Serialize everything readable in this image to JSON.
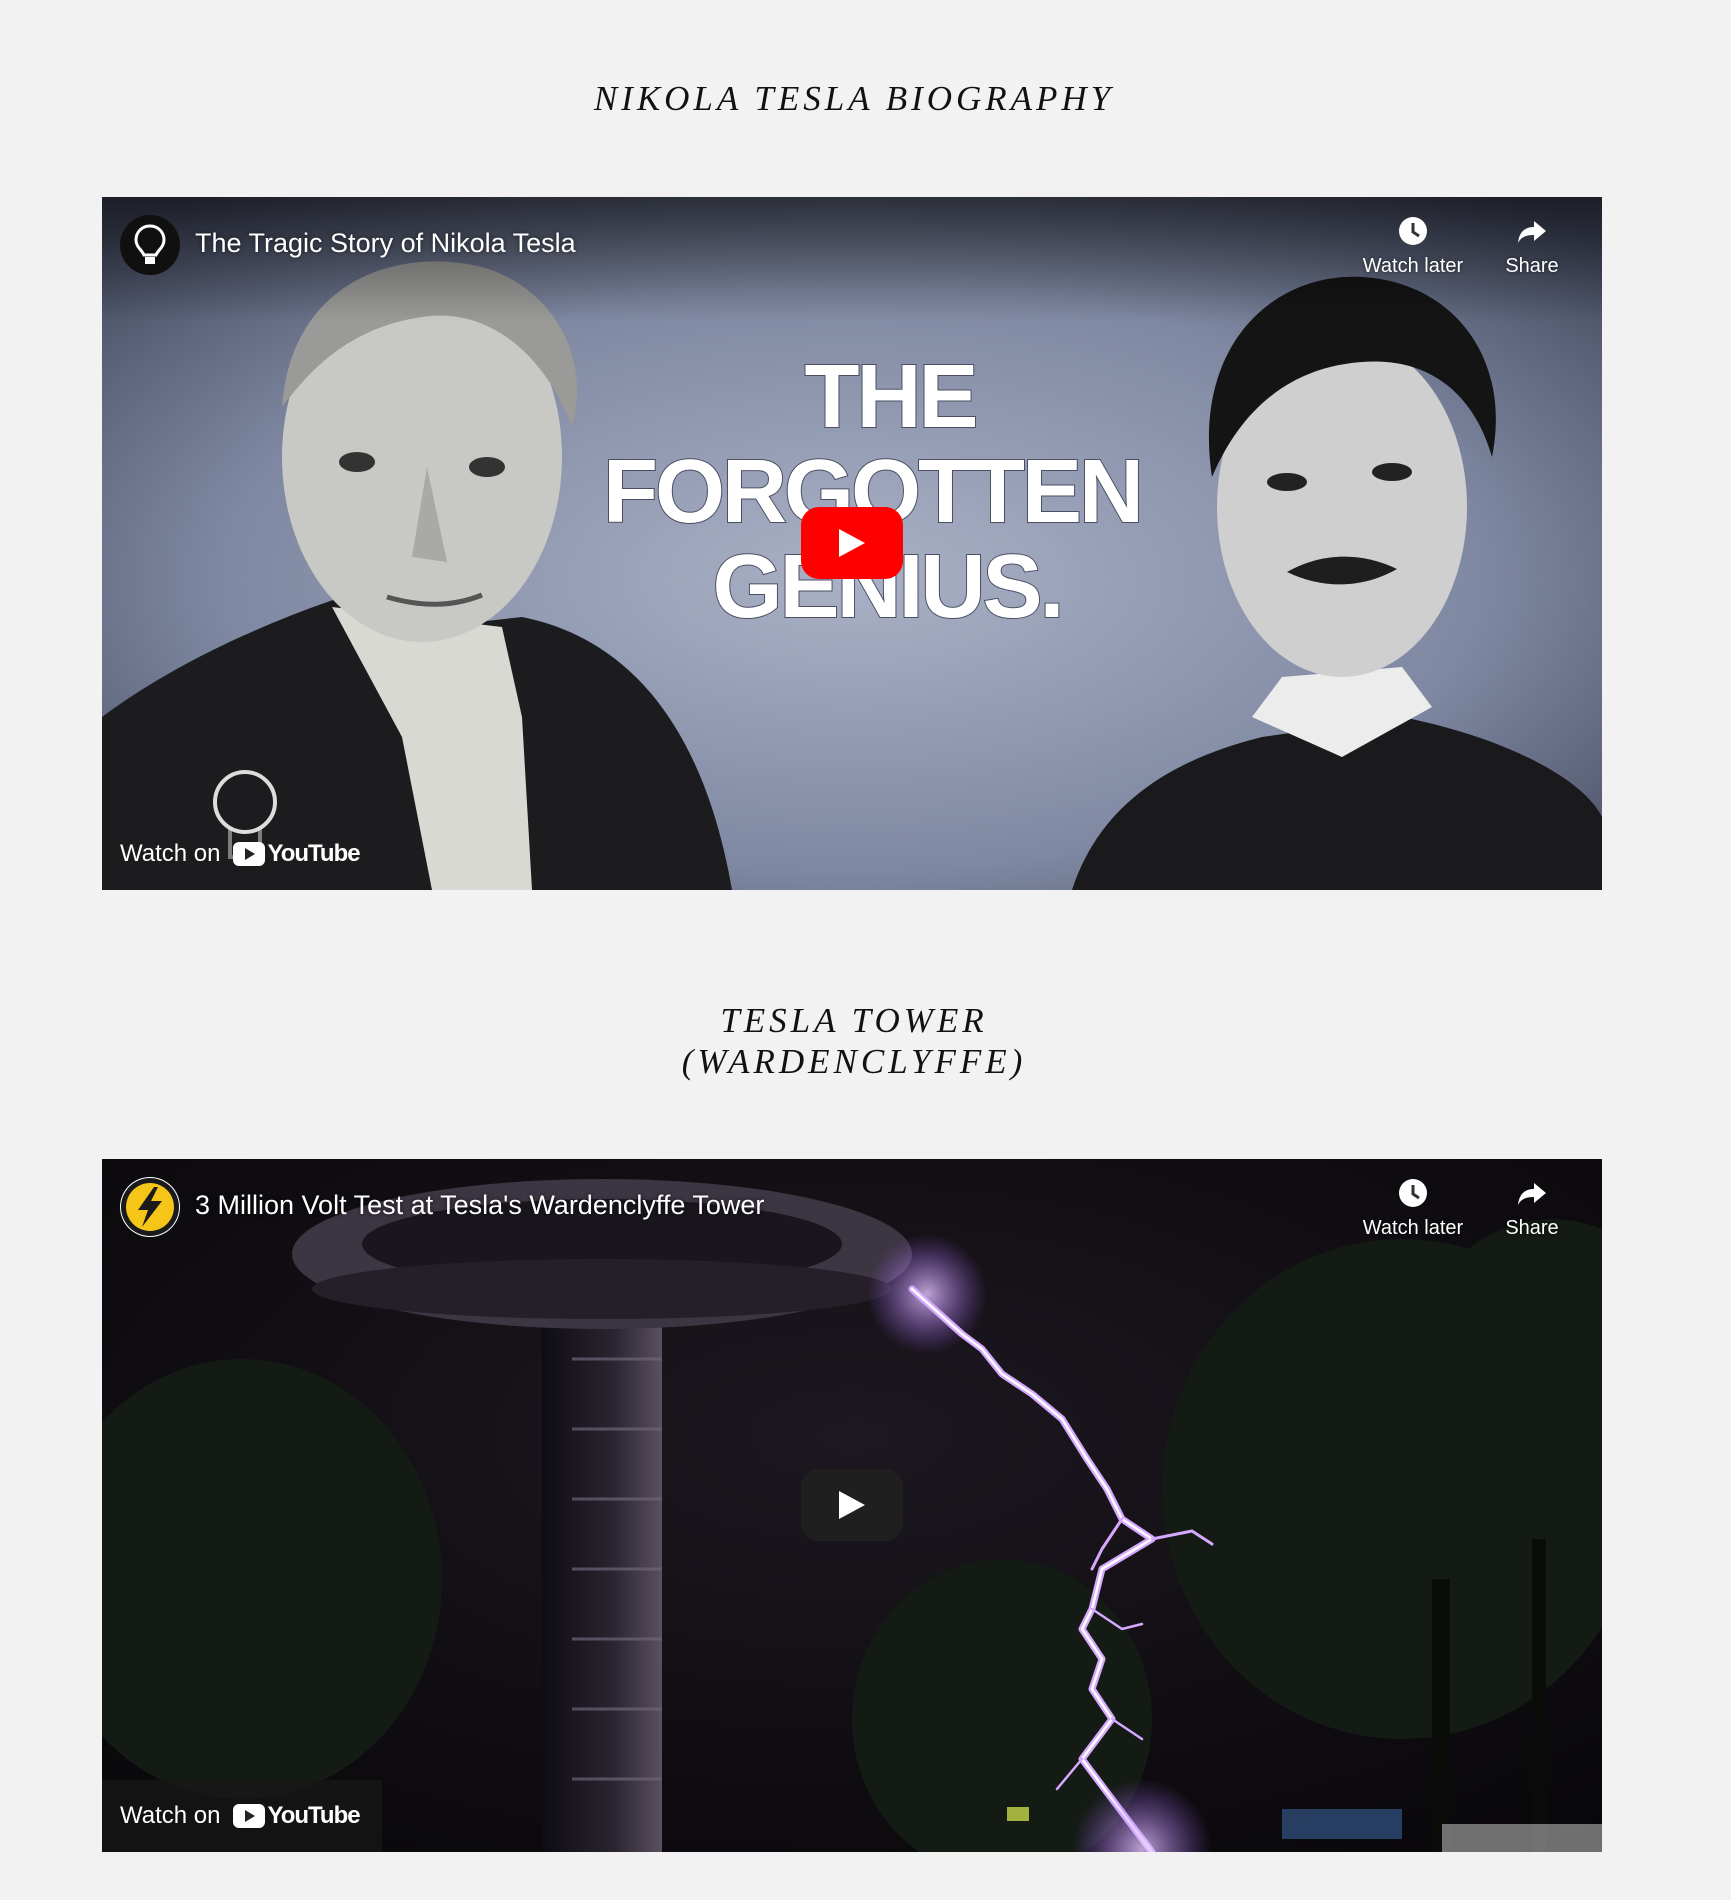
{
  "sections": [
    {
      "title": "NIKOLA TESLA BIOGRAPHY",
      "video": {
        "title": "The Tragic Story of Nikola Tesla",
        "channel_icon": "lightbulb-icon",
        "thumbnail_text": [
          "THE",
          "FORGOTTEN",
          "GENIUS."
        ],
        "watch_later_label": "Watch later",
        "share_label": "Share",
        "watch_on_label": "Watch on",
        "youtube_label": "YouTube",
        "play_button_color": "#ff0000"
      }
    },
    {
      "title_lines": [
        "TESLA TOWER",
        "(WARDENCLYFFE)"
      ],
      "video": {
        "title": "3 Million Volt Test at Tesla's Wardenclyffe Tower",
        "channel_icon": "lightning-bolt-icon",
        "watch_later_label": "Watch later",
        "share_label": "Share",
        "watch_on_label": "Watch on",
        "youtube_label": "YouTube",
        "play_button_color": "#212121"
      }
    }
  ],
  "colors": {
    "page_background": "#f2f2f2",
    "heading_text": "#111111",
    "lightning": "#c98cff"
  }
}
